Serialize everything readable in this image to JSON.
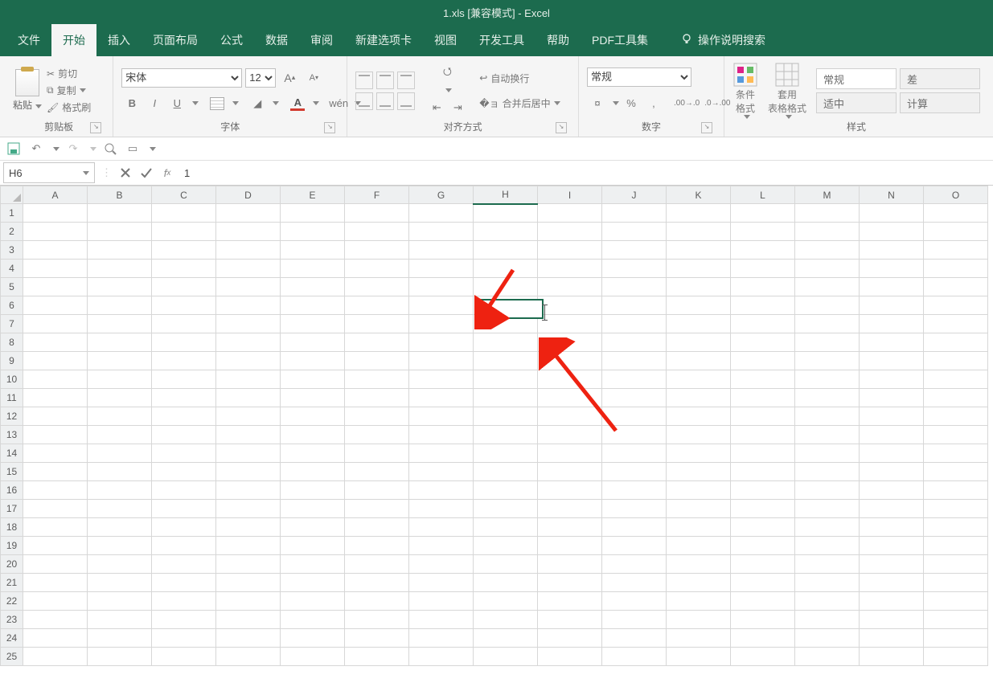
{
  "title": "1.xls  [兼容模式]  -  Excel",
  "tabs": [
    "文件",
    "开始",
    "插入",
    "页面布局",
    "公式",
    "数据",
    "审阅",
    "新建选项卡",
    "视图",
    "开发工具",
    "帮助",
    "PDF工具集"
  ],
  "active_tab_index": 1,
  "tell_me": "操作说明搜索",
  "clipboard": {
    "paste": "粘贴",
    "cut": "剪切",
    "copy": "复制",
    "format_painter": "格式刷",
    "label": "剪贴板"
  },
  "font": {
    "name": "宋体",
    "size": "12",
    "label": "字体"
  },
  "alignment": {
    "wrap": "自动换行",
    "merge": "合并后居中",
    "label": "对齐方式"
  },
  "number": {
    "format": "常规",
    "percent": "%",
    "comma": ",",
    "label": "数字"
  },
  "styles": {
    "cond": "条件格式",
    "table": "套用\n表格格式",
    "cells": [
      "常规",
      "差",
      "适中",
      "计算"
    ],
    "label": "样式"
  },
  "name_box": "H6",
  "formula_value": "1",
  "columns": [
    "A",
    "B",
    "C",
    "D",
    "E",
    "F",
    "G",
    "H",
    "I",
    "J",
    "K",
    "L",
    "M",
    "N",
    "O"
  ],
  "active_column": "H",
  "rows": [
    "1",
    "2",
    "3",
    "4",
    "5",
    "6",
    "7",
    "8",
    "9",
    "10",
    "11",
    "12",
    "13",
    "14",
    "15",
    "16",
    "17",
    "18",
    "19",
    "20",
    "21",
    "22",
    "23",
    "24",
    "25"
  ],
  "active_row": "6",
  "active_cell_value": "1"
}
